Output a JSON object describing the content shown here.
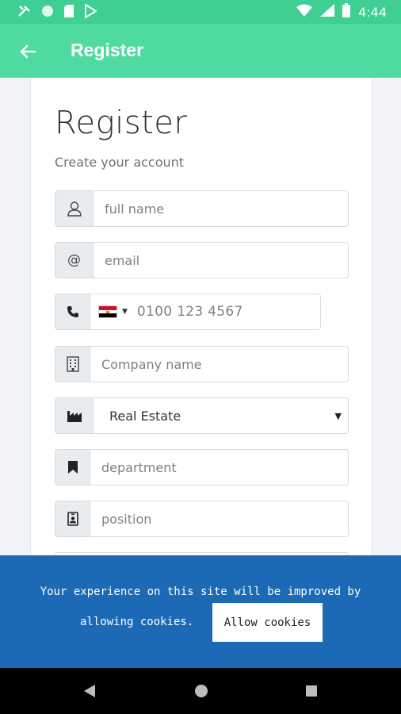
{
  "status_bar": {
    "time": "4:44",
    "left_icons": [
      "tools-icon",
      "circle-icon",
      "sd-card-icon",
      "play-store-icon"
    ],
    "right_icons": [
      "wifi-icon",
      "signal-icon",
      "battery-icon"
    ]
  },
  "app_bar": {
    "title": "Register",
    "back_icon": "arrow-left-icon"
  },
  "form": {
    "heading": "Register",
    "subheading": "Create your account",
    "full_name": {
      "placeholder": "full name",
      "icon": "user-icon"
    },
    "email": {
      "placeholder": "email",
      "icon": "at-icon"
    },
    "phone": {
      "placeholder": "0100 123 4567",
      "icon": "phone-icon",
      "country": "Egypt"
    },
    "company": {
      "placeholder": "Company name",
      "icon": "building-icon"
    },
    "industry": {
      "value": "Real Estate",
      "icon": "industry-icon"
    },
    "department": {
      "placeholder": "department",
      "icon": "bookmark-icon"
    },
    "position": {
      "placeholder": "position",
      "icon": "id-badge-icon"
    }
  },
  "cookie_banner": {
    "text_line1": "Your experience on this site will be improved by",
    "text_line2": "allowing cookies.",
    "button_label": "Allow cookies"
  },
  "colors": {
    "status_bar": "#3fcf93",
    "app_bar": "#4fdb9f",
    "cookie_banner": "#1c6ab5",
    "nav_bar": "#000000"
  }
}
